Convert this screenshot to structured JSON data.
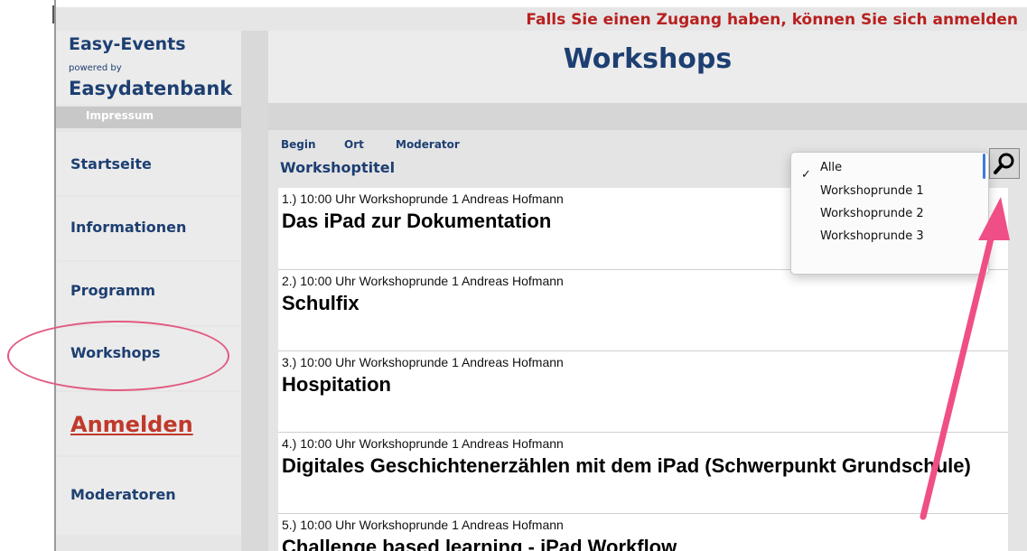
{
  "banner": {
    "login_hint": "Falls Sie einen Zugang haben, können Sie sich anmelden"
  },
  "brand": {
    "title": "Easy-Events",
    "powered_by": "powered by",
    "name": "Easydatenbank"
  },
  "sidebar": {
    "impressum": "Impressum",
    "items": [
      {
        "label": "Startseite"
      },
      {
        "label": "Informationen"
      },
      {
        "label": "Programm"
      },
      {
        "label": "Workshops"
      },
      {
        "label": "Anmelden"
      },
      {
        "label": "Moderatoren"
      }
    ]
  },
  "header": {
    "title": "Workshops"
  },
  "sort": {
    "begin": "Begin",
    "ort": "Ort",
    "moderator": "Moderator",
    "title": "Workshoptitel"
  },
  "filter": {
    "selected": "Alle",
    "check_mark": "✓",
    "options": [
      "Alle",
      "Workshoprunde 1",
      "Workshoprunde 2",
      "Workshoprunde 3"
    ]
  },
  "icons": {
    "search": "search-icon",
    "arrow": "pink-annotation-arrow",
    "circle": "pink-annotation-circle"
  },
  "colors": {
    "accent": "#1d3f72",
    "alert": "#b82020",
    "annotation": "#e15a80"
  },
  "workshops": [
    {
      "meta": "1.) 10:00 Uhr Workshoprunde 1  Andreas Hofmann",
      "title": "Das iPad zur Dokumentation"
    },
    {
      "meta": "2.) 10:00 Uhr Workshoprunde 1  Andreas Hofmann",
      "title": "Schulfix"
    },
    {
      "meta": "3.) 10:00 Uhr Workshoprunde 1  Andreas Hofmann",
      "title": "Hospitation"
    },
    {
      "meta": "4.) 10:00 Uhr Workshoprunde 1  Andreas Hofmann",
      "title": "Digitales Geschichtenerzählen mit dem iPad (Schwerpunkt Grundschule)"
    },
    {
      "meta": "5.) 10:00 Uhr Workshoprunde 1  Andreas Hofmann",
      "title": "Challenge based learning - iPad Workflow"
    }
  ]
}
